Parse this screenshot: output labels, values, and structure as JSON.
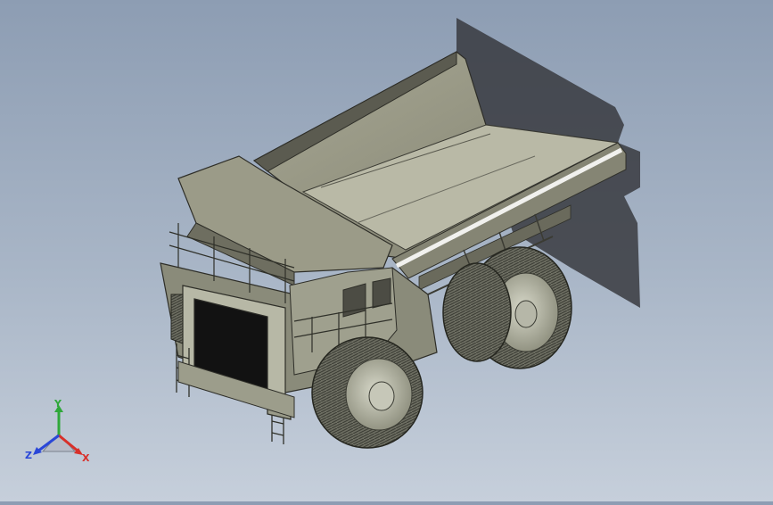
{
  "viewport": {
    "name": "3d-model-viewport",
    "background_top": "#8d9db3",
    "background_bottom": "#c6cfdb",
    "model": "mining-dump-truck"
  },
  "triad": {
    "x_label": "X",
    "y_label": "Y",
    "z_label": "Z",
    "x_color": "#d8302a",
    "y_color": "#2fa83a",
    "z_color": "#2a47d8"
  }
}
